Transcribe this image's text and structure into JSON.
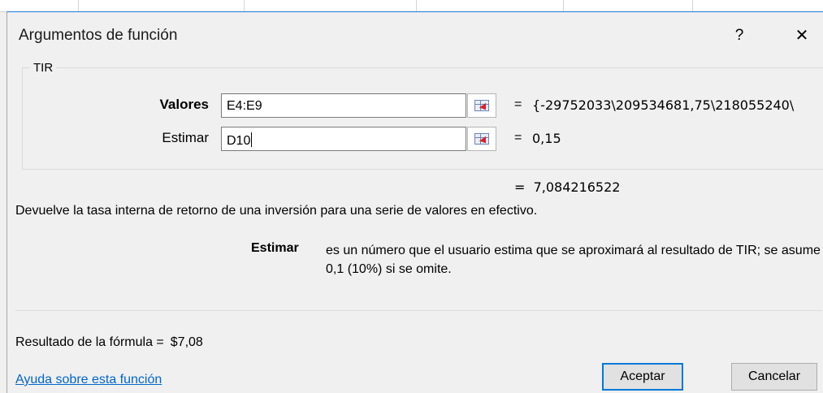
{
  "dialog": {
    "title": "Argumentos de función",
    "help_glyph": "?",
    "close_glyph": "✕"
  },
  "function": {
    "name": "TIR",
    "args": [
      {
        "label": "Valores",
        "bold": true,
        "input": "E4:E9",
        "value": "{-29752033\\209534681,75\\218055240\\"
      },
      {
        "label": "Estimar",
        "bold": false,
        "input": "D10",
        "value": "0,15"
      }
    ],
    "equals": "=",
    "result": "7,084216522",
    "description": "Devuelve la tasa interna de retorno de una inversión para una serie de valores en efectivo.",
    "param_name": "Estimar",
    "param_description": "es un número que el usuario estima que se aproximará al resultado de TIR; se asume 0,1 (10%) si se omite."
  },
  "footer": {
    "formula_result_label": "Resultado de la fórmula =",
    "formula_result_value": "$7,08",
    "help_link": "Ayuda sobre esta función",
    "ok_label": "Aceptar",
    "cancel_label": "Cancelar"
  },
  "colors": {
    "link": "#0066cc",
    "focus_border": "#0078d7",
    "dialog_bg": "#f0f0f0"
  },
  "icons": {
    "ref_button": "range-select-icon"
  }
}
